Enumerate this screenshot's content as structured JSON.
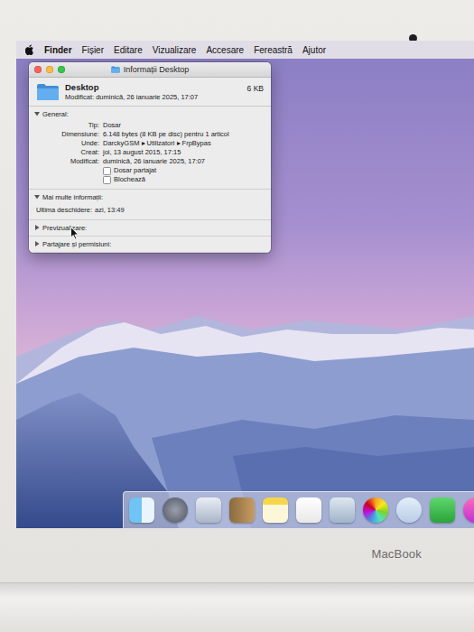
{
  "menu_bar": {
    "app": "Finder",
    "items": [
      "Fișier",
      "Editare",
      "Vizualizare",
      "Accesare",
      "Fereastră",
      "Ajutor"
    ]
  },
  "window": {
    "title": "Informații Desktop",
    "name": "Desktop",
    "modified": "Modificat: duminică, 26 ianuarie 2025, 17:07",
    "size": "6 KB"
  },
  "sections": [
    {
      "title": "General:",
      "expanded": true,
      "rows": [
        {
          "kind": "field",
          "label": "Tip:",
          "value": "Dosar"
        },
        {
          "kind": "field",
          "label": "Dimensiune:",
          "value": "6.148 bytes (8 KB pe disc) pentru 1 articol"
        },
        {
          "kind": "field",
          "label": "Unde:",
          "value": "DarckyGSM ▸ Utilizatori ▸ FrpBypas"
        },
        {
          "kind": "field",
          "label": "Creat:",
          "value": "joi, 13 august 2015, 17:15"
        },
        {
          "kind": "field",
          "label": "Modificat:",
          "value": "duminică, 26 ianuarie 2025, 17:07"
        },
        {
          "kind": "checkbox",
          "label": "Dosar partajat",
          "checked": false
        },
        {
          "kind": "checkbox",
          "label": "Blochează",
          "checked": false
        }
      ]
    },
    {
      "title": "Mai multe informații:",
      "expanded": true,
      "rows": [
        {
          "kind": "inline",
          "label": "Ultima deschidere:",
          "value": "azi, 13:49"
        }
      ]
    },
    {
      "title": "Previzualizare:",
      "expanded": false,
      "rows": []
    },
    {
      "title": "Partajare și permisiuni:",
      "expanded": false,
      "rows": []
    }
  ],
  "bezel": {
    "brand": "MacBook"
  }
}
